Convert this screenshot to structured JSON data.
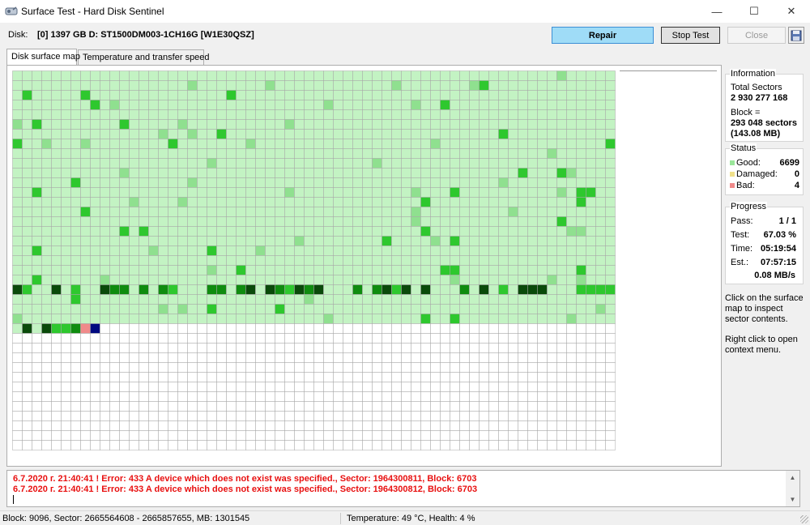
{
  "window": {
    "title": "Surface Test - Hard Disk Sentinel",
    "minimize_glyph": "—",
    "maximize_glyph": "☐",
    "close_glyph": "✕"
  },
  "disk": {
    "label": "Disk:",
    "name": "[0] 1397 GB D: ST1500DM003-1CH16G [W1E30QSZ]"
  },
  "toolbar": {
    "repair_label": "Repair",
    "stop_label": "Stop Test",
    "close_label": "Close",
    "save_icon": "floppy-disk-icon"
  },
  "tabs": [
    {
      "label": "Disk surface map",
      "active": true
    },
    {
      "label": "Temperature and transfer speed",
      "active": false
    }
  ],
  "surface_map": {
    "columns": 62,
    "rows": 39,
    "total_blocks": 10000,
    "tested_blocks": 6703,
    "colors": {
      "untested": "#ffffff",
      "good": "#c3f3c3",
      "good_medium": "#8fe08f",
      "good_active": "#2ec82e",
      "good_dark": "#0f8c0f",
      "good_darkest": "#0a4a0a",
      "bad": "#f08a8a",
      "current": "#000a80",
      "gridline": "#a8a8a8"
    },
    "bad_block_indices": [
      6697,
      6698,
      6699,
      6700
    ],
    "current_block_index": 6701
  },
  "information": {
    "title": "Information",
    "total_sectors_label": "Total Sectors",
    "total_sectors": "2 930 277 168",
    "block_label": "Block =",
    "block_sectors": "293 048 sectors",
    "block_size": "(143.08 MB)"
  },
  "status": {
    "title": "Status",
    "good_label": "Good:",
    "good_value": "6699",
    "good_color": "#9ae69a",
    "damaged_label": "Damaged:",
    "damaged_value": "0",
    "damaged_color": "#f0e08a",
    "bad_label": "Bad:",
    "bad_value": "4",
    "bad_color": "#f08a8a"
  },
  "progress": {
    "title": "Progress",
    "pass_label": "Pass:",
    "pass_value": "1 / 1",
    "test_label": "Test:",
    "test_value": "67.03 %",
    "time_label": "Time:",
    "time_value": "05:19:54",
    "est_label": "Est.:",
    "est_value": "07:57:15",
    "speed": "0.08 MB/s"
  },
  "hints": {
    "click": "Click on the surface map to inspect sector contents.",
    "right_click": "Right click to open context menu."
  },
  "log": {
    "lines": [
      "6.7.2020 г.  21:40:41 ! Error: 433 A device which does not exist was specified., Sector: 1964300811, Block: 6703",
      "6.7.2020 г.  21:40:41 ! Error: 433 A device which does not exist was specified., Sector: 1964300812, Block: 6703"
    ],
    "color": "#e81010"
  },
  "statusbar": {
    "block_info": "Block: 9096, Sector: 2665564608 - 2665857655, MB: 1301545",
    "health_info": "Temperature: 49  °C, Health: 4 %"
  }
}
